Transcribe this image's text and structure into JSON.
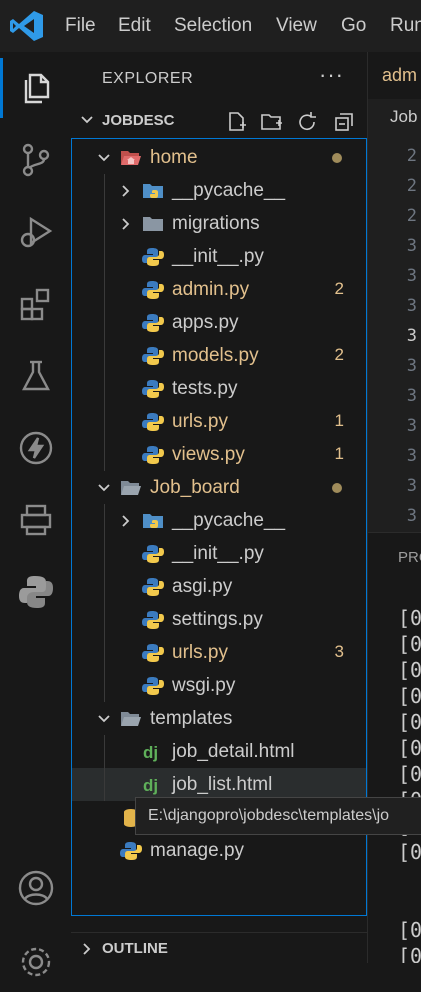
{
  "menu": [
    "File",
    "Edit",
    "Selection",
    "View",
    "Go",
    "Run"
  ],
  "explorer": {
    "title": "EXPLORER",
    "more": "···",
    "folder": "JOBDESC",
    "tree": [
      {
        "label": "home",
        "type": "folder-open",
        "depth": 0,
        "status": "dot",
        "color": "mod"
      },
      {
        "label": "__pycache__",
        "type": "folder-closed",
        "depth": 1,
        "color": "norm"
      },
      {
        "label": "migrations",
        "type": "folder-closed",
        "depth": 1,
        "color": "norm"
      },
      {
        "label": "__init__.py",
        "type": "py",
        "depth": 1,
        "color": "norm"
      },
      {
        "label": "admin.py",
        "type": "py",
        "depth": 1,
        "badge": "2",
        "color": "mod"
      },
      {
        "label": "apps.py",
        "type": "py",
        "depth": 1,
        "color": "norm"
      },
      {
        "label": "models.py",
        "type": "py",
        "depth": 1,
        "badge": "2",
        "color": "mod"
      },
      {
        "label": "tests.py",
        "type": "py",
        "depth": 1,
        "color": "norm"
      },
      {
        "label": "urls.py",
        "type": "py",
        "depth": 1,
        "badge": "1",
        "color": "mod"
      },
      {
        "label": "views.py",
        "type": "py",
        "depth": 1,
        "badge": "1",
        "color": "mod"
      },
      {
        "label": "Job_board",
        "type": "folder-open",
        "depth": 0,
        "status": "dot",
        "color": "mod"
      },
      {
        "label": "__pycache__",
        "type": "folder-closed",
        "depth": 1,
        "color": "norm"
      },
      {
        "label": "__init__.py",
        "type": "py",
        "depth": 1,
        "color": "norm"
      },
      {
        "label": "asgi.py",
        "type": "py",
        "depth": 1,
        "color": "norm"
      },
      {
        "label": "settings.py",
        "type": "py",
        "depth": 1,
        "color": "norm"
      },
      {
        "label": "urls.py",
        "type": "py",
        "depth": 1,
        "badge": "3",
        "color": "mod"
      },
      {
        "label": "wsgi.py",
        "type": "py",
        "depth": 1,
        "color": "norm"
      },
      {
        "label": "templates",
        "type": "folder-open",
        "depth": 0,
        "color": "norm"
      },
      {
        "label": "job_detail.html",
        "type": "dj",
        "depth": 1,
        "color": "norm"
      },
      {
        "label": "job_list.html",
        "type": "dj",
        "depth": 1,
        "color": "norm",
        "hover": true
      },
      {
        "label": "",
        "type": "db",
        "depth": 0,
        "color": "norm"
      },
      {
        "label": "manage.py",
        "type": "py",
        "depth": 0,
        "color": "norm"
      }
    ],
    "outline": "OUTLINE"
  },
  "editor": {
    "tab_label": "adm",
    "breadcrumb": "Job",
    "line_numbers": [
      "2",
      "2",
      "2",
      "3",
      "3",
      "3",
      "3",
      "3",
      "3",
      "3",
      "3",
      "3",
      "3",
      "3",
      "4"
    ],
    "panel_header": "PRO",
    "terminal_lines": [
      "[0",
      "[0",
      "[0",
      "[0",
      "[0",
      "[0",
      "[0",
      "[0",
      "[0",
      "[0",
      "[0",
      "[0",
      "[0",
      "[0"
    ]
  },
  "tooltip": "E:\\djangopro\\jobdesc\\templates\\jo"
}
